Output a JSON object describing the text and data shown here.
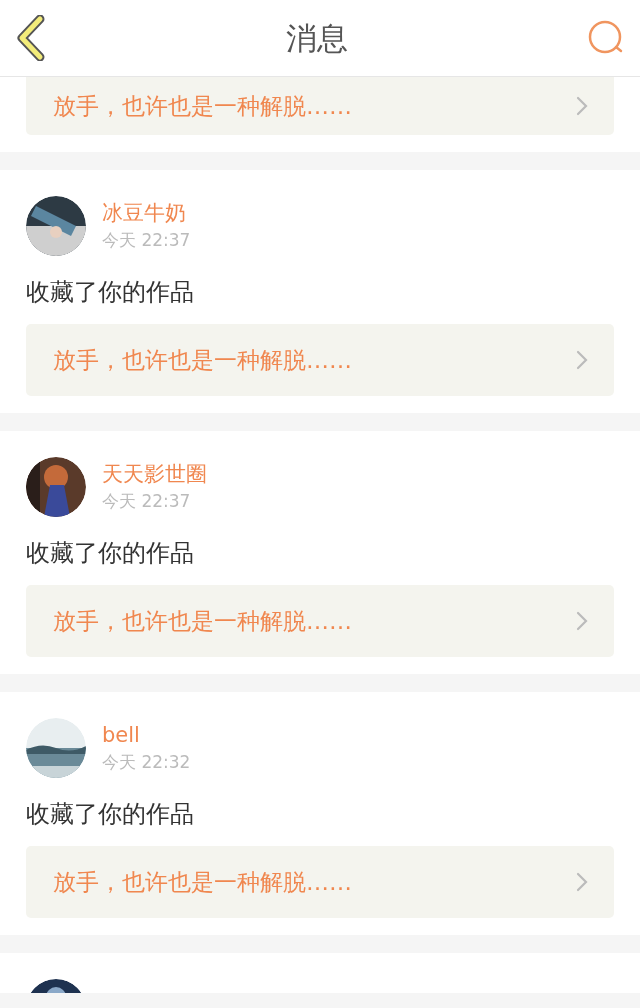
{
  "header": {
    "title": "消息"
  },
  "messages": [
    {
      "kind": "cut_top",
      "work_title": "放手，也许也是一种解脱……"
    },
    {
      "kind": "full",
      "user": "冰豆牛奶",
      "time": "今天 22:37",
      "action": "收藏了你的作品",
      "work_title": "放手，也许也是一种解脱……"
    },
    {
      "kind": "full",
      "user": "天天影世圈",
      "time": "今天 22:37",
      "action": "收藏了你的作品",
      "work_title": "放手，也许也是一种解脱……"
    },
    {
      "kind": "full",
      "user": "bell",
      "time": "今天 22:32",
      "action": "收藏了你的作品",
      "work_title": "放手，也许也是一种解脱……"
    },
    {
      "kind": "cut_bottom"
    }
  ]
}
